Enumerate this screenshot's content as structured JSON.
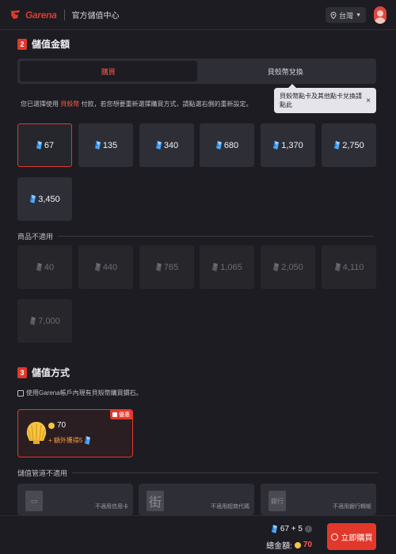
{
  "colors": {
    "accent": "#e1382b",
    "highlight": "#ff5a4a",
    "background": "#1c1c22",
    "card": "#2e2e36"
  },
  "header": {
    "brand": "Garena",
    "title": "官方儲值中心",
    "region": "台灣"
  },
  "amount_section": {
    "number": "2",
    "title": "儲值金額",
    "tabs": [
      {
        "label": "購買",
        "active": true
      },
      {
        "label": "貝殼幣兌換",
        "active": false
      }
    ],
    "notice_prefix": "您已選擇使用",
    "notice_method": "貝殼幣",
    "notice_suffix": "付款，若您想要重新選擇購買方式，請點選右側的重新設定。",
    "tooltip": "貝殼幣點卡及其他點卡兌換請點此",
    "available": [
      "67",
      "135",
      "340",
      "680",
      "1,370",
      "2,750",
      "3,450"
    ],
    "selected": "67",
    "unavailable_label": "商品不適用",
    "unavailable": [
      "40",
      "440",
      "765",
      "1,065",
      "2,050",
      "4,110",
      "7,000"
    ]
  },
  "payment_section": {
    "number": "3",
    "title": "儲值方式",
    "note": "使用Garena帳戶內現有貝殼幣購買鑽石。",
    "method": {
      "amount": "70",
      "bonus": "+ 額外獲得5",
      "badge": "優惠"
    },
    "unavailable_label": "儲值管道不適用",
    "unavailable": [
      {
        "icon": "card",
        "text": "不適用信用卡"
      },
      {
        "icon": "街",
        "text": "不適用超商代碼"
      },
      {
        "icon": "銀行",
        "text": "不適用銀行轉帳"
      }
    ]
  },
  "footer": {
    "total": "67 + 5",
    "price_label": "總金額:",
    "price": "70",
    "buy_label": "立即購買"
  }
}
